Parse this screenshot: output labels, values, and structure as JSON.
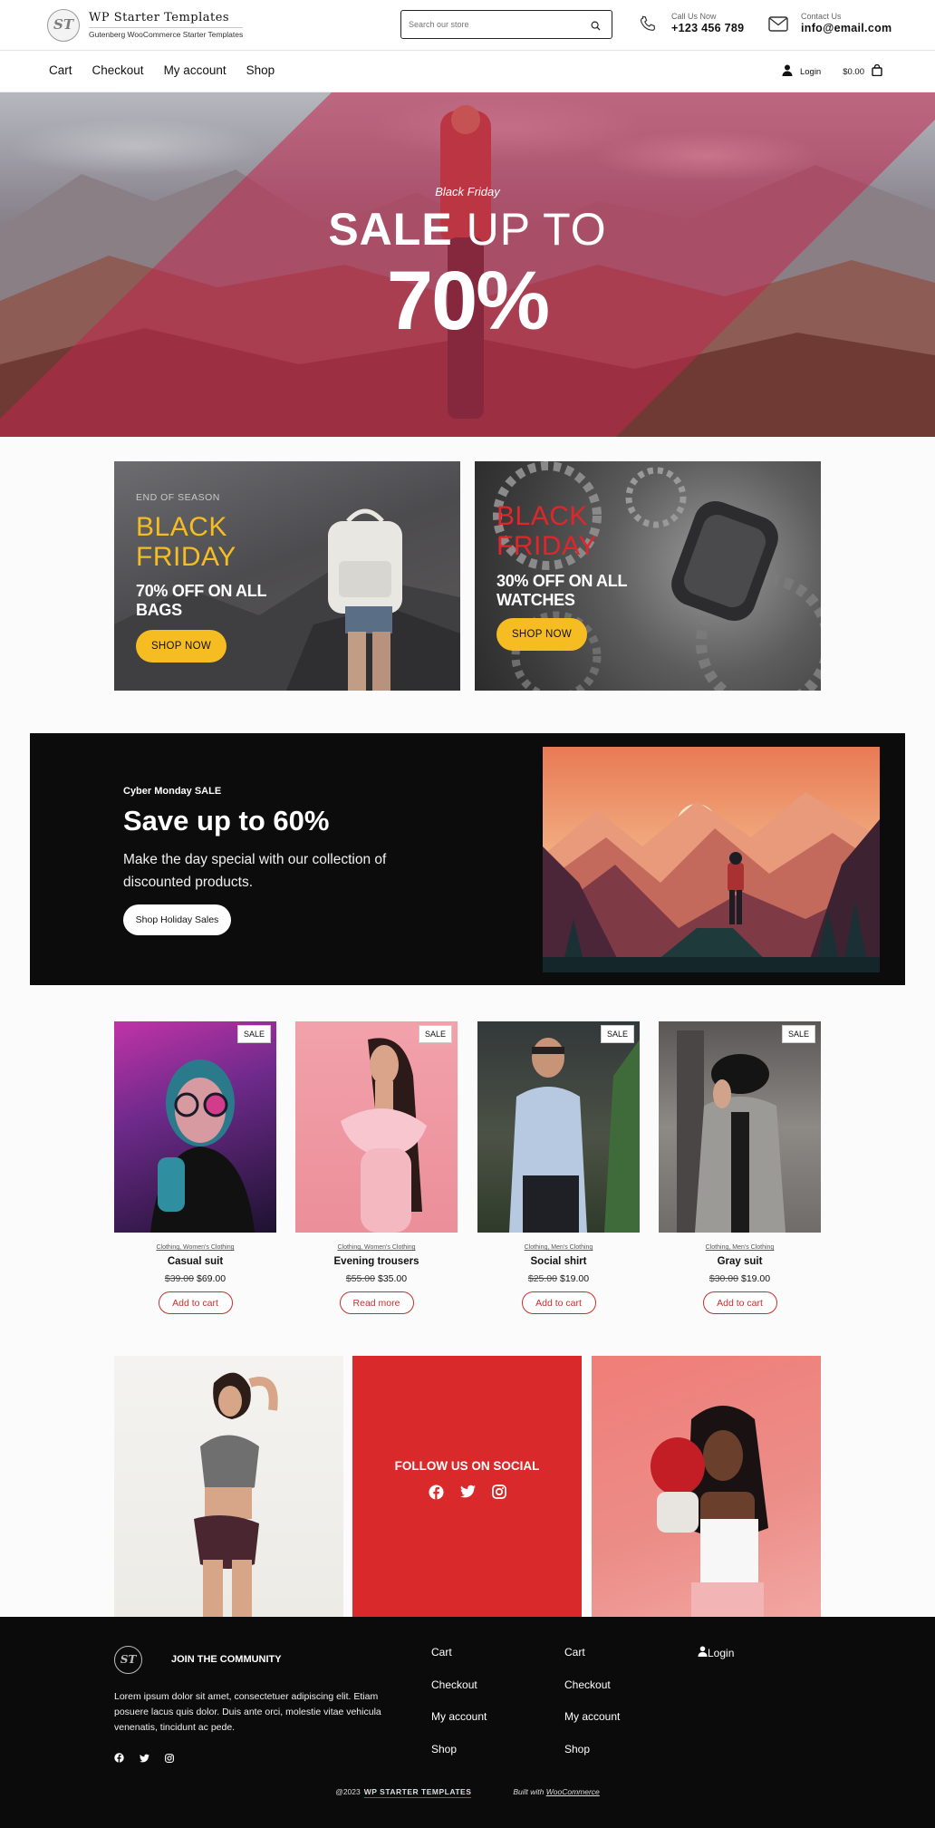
{
  "header": {
    "logo_text": "ST",
    "brand_title": "WP Starter Templates",
    "brand_subtitle": "Gutenberg WooCommerce Starter Templates",
    "search_placeholder": "Search our store",
    "call_label": "Call Us Now",
    "call_value": "+123 456 789",
    "contact_label": "Contact Us",
    "contact_value": "info@email.com"
  },
  "nav": {
    "links": [
      "Cart",
      "Checkout",
      "My account",
      "Shop"
    ],
    "login_label": "Login",
    "cart_total": "$0.00"
  },
  "hero": {
    "kicker": "Black Friday",
    "line_bold": "SALE",
    "line_light": " UP TO",
    "big": "70%"
  },
  "promos": [
    {
      "small": "END OF SEASON",
      "title_line1": "BLACK",
      "title_line2": "FRIDAY",
      "sub_line1": "70% OFF ON ALL",
      "sub_line2": "BAGS",
      "button": "SHOP NOW",
      "title_color": "#f6bd22"
    },
    {
      "small": "",
      "title_line1": "BLACK",
      "title_line2": "FRIDAY",
      "sub_line1": "30% OFF ON ALL",
      "sub_line2": "WATCHES",
      "button": "SHOP NOW",
      "title_color": "#e0262a"
    }
  ],
  "cyber": {
    "kicker": "Cyber Monday SALE",
    "title": "Save up to 60%",
    "description": "Make the day special with our collection of discounted products.",
    "button": "Shop Holiday Sales"
  },
  "products": [
    {
      "badge": "SALE",
      "categories": "Clothing, Women's Clothing",
      "name": "Casual suit",
      "old_price": "$39.00",
      "price": "$69.00",
      "button": "Add to cart"
    },
    {
      "badge": "SALE",
      "categories": "Clothing, Women's Clothing",
      "name": "Evening trousers",
      "old_price": "$55.00",
      "price": "$35.00",
      "button": "Read more"
    },
    {
      "badge": "SALE",
      "categories": "Clothing, Men's Clothing",
      "name": "Social shirt",
      "old_price": "$25.00",
      "price": "$19.00",
      "button": "Add to cart"
    },
    {
      "badge": "SALE",
      "categories": "Clothing, Men's Clothing",
      "name": "Gray suit",
      "old_price": "$30.00",
      "price": "$19.00",
      "button": "Add to cart"
    }
  ],
  "social": {
    "title": "FOLLOW US ON SOCIAL",
    "icons": [
      "facebook-icon",
      "twitter-icon",
      "instagram-icon"
    ]
  },
  "footer": {
    "logo_text": "ST",
    "join": "JOIN THE COMMUNITY",
    "text": "Lorem ipsum dolor sit amet, consectetuer adipiscing elit. Etiam posuere lacus quis dolor. Duis ante orci, molestie vitae vehicula venenatis, tincidunt ac pede.",
    "col1": [
      "Cart",
      "Checkout",
      "My account",
      "Shop"
    ],
    "col2": [
      "Cart",
      "Checkout",
      "My account",
      "Shop"
    ],
    "login": "Login",
    "copyright": "@2023",
    "brand": "WP STARTER TEMPLATES",
    "built_prefix": "Built with ",
    "built_link": "WooCommerce"
  },
  "colors": {
    "accent_red": "#d9292b",
    "accent_yellow": "#f6bd22",
    "dark": "#0d0c0d"
  }
}
